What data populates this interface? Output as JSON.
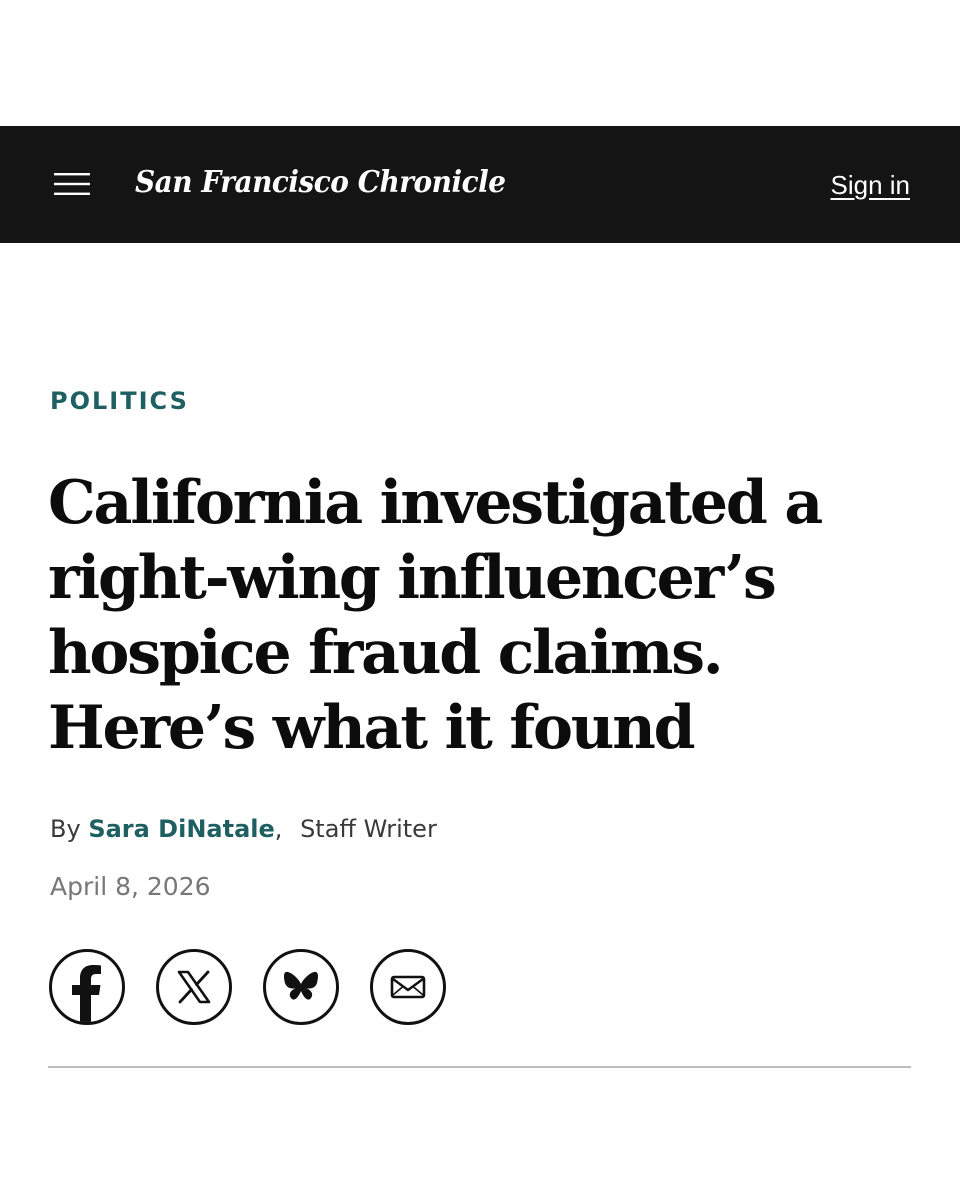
{
  "header": {
    "masthead": "San Francisco Chronicle",
    "sign_in_label": "Sign in",
    "menu_icon": "hamburger-menu-icon",
    "background_color": "#141414"
  },
  "article": {
    "section": "POLITICS",
    "headline": "California investigated a right-wing influencer’s hospice fraud claims. Here’s what it found",
    "byline": {
      "prefix": "By",
      "author": "Sara DiNatale",
      "separator": ",",
      "role": "Staff Writer"
    },
    "date": "April 8, 2026"
  },
  "share": {
    "buttons": [
      {
        "name": "facebook",
        "icon": "facebook-icon"
      },
      {
        "name": "x",
        "icon": "x-icon"
      },
      {
        "name": "bluesky",
        "icon": "bluesky-icon"
      },
      {
        "name": "email",
        "icon": "email-icon"
      }
    ]
  },
  "colors": {
    "accent": "#1e5f62",
    "text": "#111111",
    "muted": "#777777",
    "divider": "#bdbdbd"
  }
}
